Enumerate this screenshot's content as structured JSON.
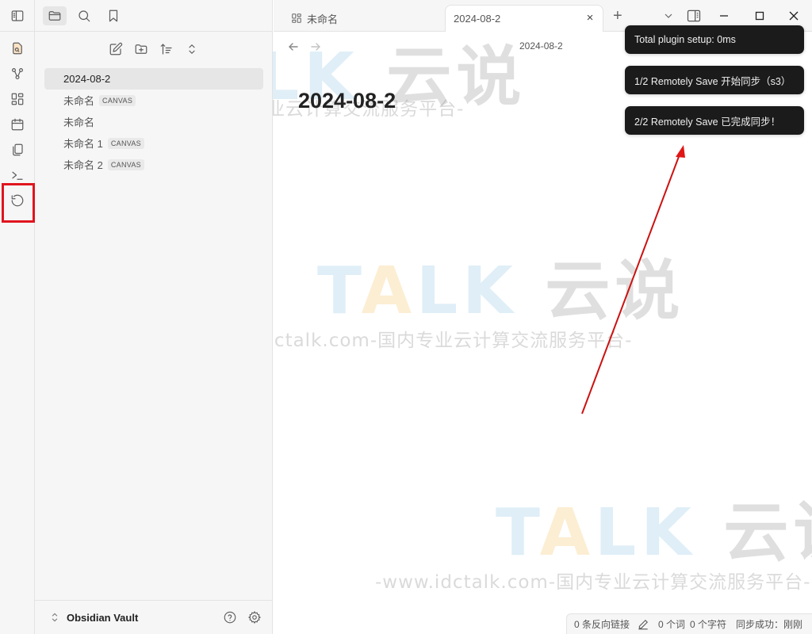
{
  "ribbon": {
    "icons": [
      "search-file-icon",
      "graph-view-icon",
      "canvas-icon",
      "daily-note-calendar-icon",
      "templates-copy-icon",
      "command-palette-icon",
      "remotely-save-sync-icon"
    ],
    "highlighted": "remotely-save-sync-icon",
    "highlight_color": "#e0141e"
  },
  "sidebar": {
    "tabs": [
      "files",
      "search",
      "bookmarks"
    ],
    "active_tab": "files",
    "toolbar": [
      "new-note",
      "new-folder",
      "sort",
      "collapse-expand"
    ],
    "files": [
      {
        "name": "2024-08-2",
        "badge": "",
        "active": true
      },
      {
        "name": "未命名",
        "badge": "CANVAS",
        "active": false
      },
      {
        "name": "未命名",
        "badge": "",
        "active": false
      },
      {
        "name": "未命名 1",
        "badge": "CANVAS",
        "active": false
      },
      {
        "name": "未命名 2",
        "badge": "CANVAS",
        "active": false
      }
    ],
    "vault_name": "Obsidian Vault"
  },
  "tabs": {
    "inactive_tab_label": "未命名",
    "active_tab_label": "2024-08-2",
    "close_symbol": "×",
    "new_tab_symbol": "+"
  },
  "view": {
    "header_title": "2024-08-2",
    "note_title": "2024-08-2"
  },
  "toasts": [
    "Total plugin setup: 0ms",
    "1/2 Remotely Save 开始同步（s3）",
    "2/2 Remotely Save 已完成同步！"
  ],
  "statusbar": {
    "backlinks": "0 条反向链接",
    "words": "0 个词",
    "chars": "0 个字符",
    "sync": "同步成功：刚刚"
  },
  "watermark": {
    "logo_a": "T",
    "logo_b": "A",
    "logo_c": "LK",
    "logo_cn": "云说",
    "url_line": "-www.idctalk.com-国内专业云计算交流服务平台-"
  },
  "annotation": {
    "arrow_color": "#cc1111"
  }
}
